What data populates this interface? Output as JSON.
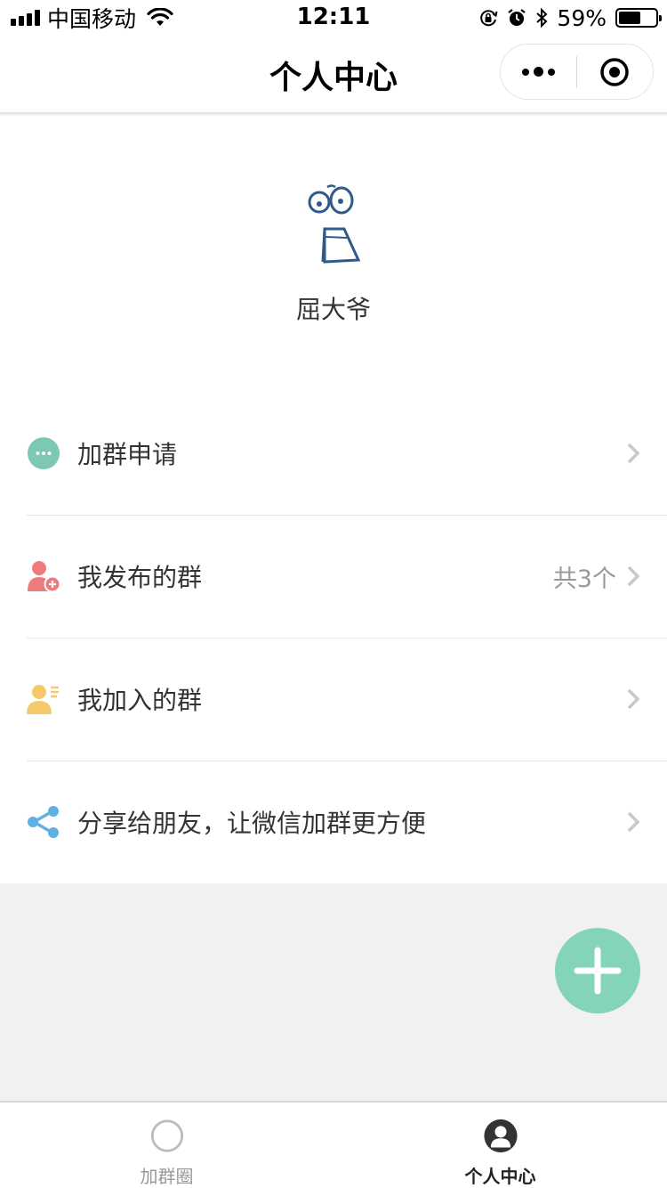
{
  "status_bar": {
    "carrier": "中国移动",
    "time": "12:11",
    "battery_pct": "59%",
    "battery_level": 0.59
  },
  "nav": {
    "title": "个人中心"
  },
  "profile": {
    "username": "屈大爷"
  },
  "menu": {
    "items": [
      {
        "label": "加群申请",
        "extra": "",
        "icon": "chat-bubble-icon",
        "color": "#7dc7b5"
      },
      {
        "label": "我发布的群",
        "extra": "共3个",
        "icon": "user-add-icon",
        "color": "#ee7b7b"
      },
      {
        "label": "我加入的群",
        "extra": "",
        "icon": "user-list-icon",
        "color": "#f5c96a"
      },
      {
        "label": "分享给朋友，让微信加群更方便",
        "extra": "",
        "icon": "share-icon",
        "color": "#5fb0e3"
      }
    ]
  },
  "fab": {
    "icon": "plus-icon",
    "color": "#84d5b8"
  },
  "tabs": [
    {
      "label": "加群圈",
      "icon": "circle-icon",
      "active": false
    },
    {
      "label": "个人中心",
      "icon": "user-icon",
      "active": true
    }
  ]
}
